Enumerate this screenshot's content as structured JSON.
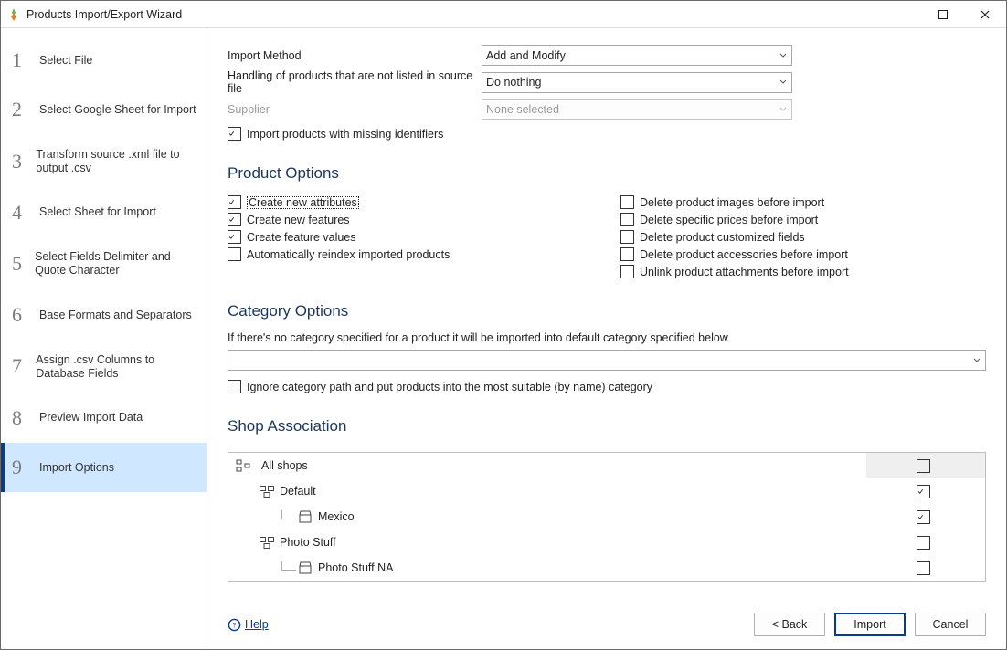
{
  "window": {
    "title": "Products Import/Export Wizard"
  },
  "sidebar": {
    "steps": [
      {
        "label": "Select File"
      },
      {
        "label": "Select Google Sheet for Import"
      },
      {
        "label": "Transform source .xml file to output .csv"
      },
      {
        "label": "Select Sheet for Import"
      },
      {
        "label": "Select Fields Delimiter and Quote Character"
      },
      {
        "label": "Base Formats and Separators"
      },
      {
        "label": "Assign .csv Columns to Database Fields"
      },
      {
        "label": "Preview Import Data"
      },
      {
        "label": "Import Options"
      }
    ]
  },
  "top": {
    "import_method_label": "Import Method",
    "import_method_value": "Add and Modify",
    "handling_label": "Handling of products that are not listed in source file",
    "handling_value": "Do nothing",
    "supplier_label": "Supplier",
    "supplier_value": "None selected",
    "import_missing_label": "Import products with missing identifiers"
  },
  "product_options": {
    "heading": "Product Options",
    "left": [
      {
        "label": "Create new attributes",
        "checked": true,
        "focused": true
      },
      {
        "label": "Create new features",
        "checked": true
      },
      {
        "label": "Create feature values",
        "checked": true
      },
      {
        "label": "Automatically reindex imported products",
        "checked": false
      }
    ],
    "right": [
      {
        "label": "Delete product images before import",
        "checked": false
      },
      {
        "label": "Delete specific prices before import",
        "checked": false
      },
      {
        "label": "Delete product customized fields",
        "checked": false
      },
      {
        "label": "Delete product accessories before import",
        "checked": false
      },
      {
        "label": "Unlink product attachments before import",
        "checked": false
      }
    ]
  },
  "category_options": {
    "heading": "Category Options",
    "desc": "If there's no category specified for a product it will be imported into default category specified below",
    "select_value": "",
    "ignore_label": "Ignore category path and put products into the most suitable (by name) category",
    "ignore_checked": false
  },
  "shop": {
    "heading": "Shop Association",
    "header_label": "All shops",
    "rows": [
      {
        "label": "Default",
        "indent": 1,
        "icon": "group",
        "checked": true
      },
      {
        "label": "Mexico",
        "indent": 2,
        "icon": "shop",
        "checked": true
      },
      {
        "label": "Photo Stuff",
        "indent": 1,
        "icon": "group",
        "checked": false
      },
      {
        "label": "Photo Stuff NA",
        "indent": 2,
        "icon": "shop",
        "checked": false
      }
    ]
  },
  "footer": {
    "help": "Help",
    "back": "< Back",
    "import": "Import",
    "cancel": "Cancel"
  }
}
